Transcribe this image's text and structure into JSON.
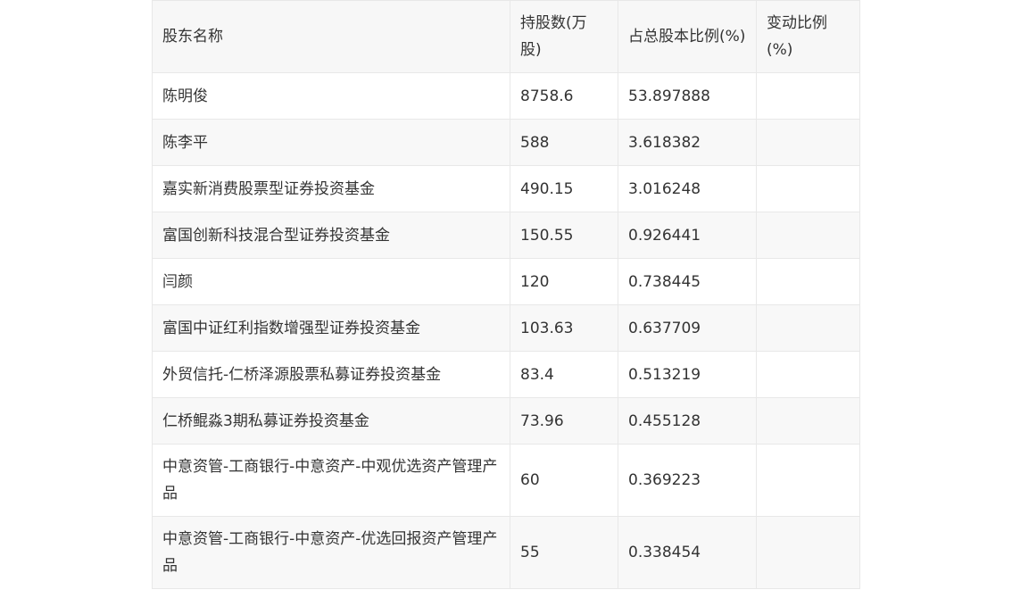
{
  "table": {
    "headers": [
      "股东名称",
      "持股数(万股)",
      "占总股本比例(%)",
      "变动比例(%)"
    ],
    "rows": [
      {
        "name": "陈明俊",
        "shares": "8758.6",
        "ratio": "53.897888",
        "change": ""
      },
      {
        "name": "陈李平",
        "shares": "588",
        "ratio": "3.618382",
        "change": ""
      },
      {
        "name": "嘉实新消费股票型证券投资基金",
        "shares": "490.15",
        "ratio": "3.016248",
        "change": ""
      },
      {
        "name": "富国创新科技混合型证券投资基金",
        "shares": "150.55",
        "ratio": "0.926441",
        "change": ""
      },
      {
        "name": "闫颜",
        "shares": "120",
        "ratio": "0.738445",
        "change": ""
      },
      {
        "name": "富国中证红利指数增强型证券投资基金",
        "shares": "103.63",
        "ratio": "0.637709",
        "change": ""
      },
      {
        "name": "外贸信托-仁桥泽源股票私募证券投资基金",
        "shares": "83.4",
        "ratio": "0.513219",
        "change": ""
      },
      {
        "name": "仁桥鲲淼3期私募证券投资基金",
        "shares": "73.96",
        "ratio": "0.455128",
        "change": ""
      },
      {
        "name": "中意资管-工商银行-中意资产-中观优选资产管理产品",
        "shares": "60",
        "ratio": "0.369223",
        "change": ""
      },
      {
        "name": "中意资管-工商银行-中意资产-优选回报资产管理产品",
        "shares": "55",
        "ratio": "0.338454",
        "change": ""
      }
    ]
  }
}
